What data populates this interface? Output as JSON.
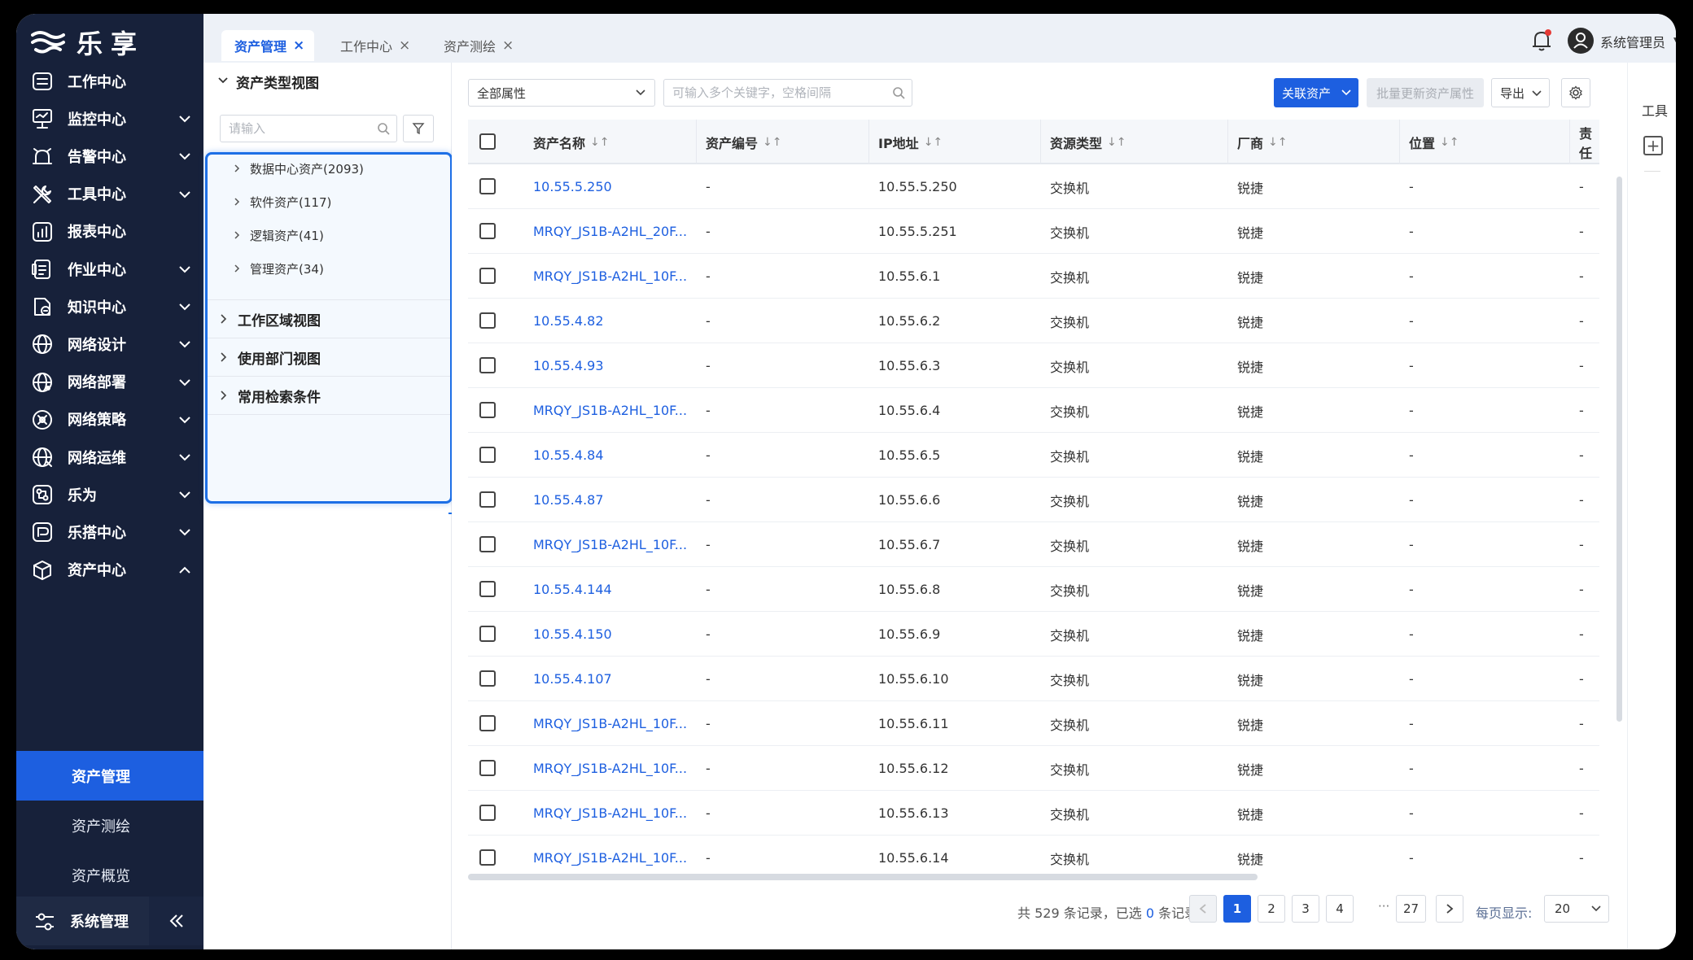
{
  "brand": {
    "name": "乐享"
  },
  "sidebar": {
    "items": [
      {
        "label": "工作中心",
        "icon": "workbench-icon",
        "expandable": false
      },
      {
        "label": "监控中心",
        "icon": "monitor-icon",
        "expandable": true
      },
      {
        "label": "告警中心",
        "icon": "alarm-clock-icon",
        "expandable": true
      },
      {
        "label": "工具中心",
        "icon": "tools-icon",
        "expandable": true
      },
      {
        "label": "报表中心",
        "icon": "report-chart-icon",
        "expandable": false
      },
      {
        "label": "作业中心",
        "icon": "job-list-icon",
        "expandable": true
      },
      {
        "label": "知识中心",
        "icon": "knowledge-icon",
        "expandable": true
      },
      {
        "label": "网络设计",
        "icon": "globe-design-icon",
        "expandable": true
      },
      {
        "label": "网络部署",
        "icon": "globe-deploy-icon",
        "expandable": true
      },
      {
        "label": "网络策略",
        "icon": "network-policy-icon",
        "expandable": true
      },
      {
        "label": "网络运维",
        "icon": "globe-ops-icon",
        "expandable": true
      },
      {
        "label": "乐为",
        "icon": "lewei-icon",
        "expandable": true
      },
      {
        "label": "乐搭中心",
        "icon": "leda-icon",
        "expandable": true
      },
      {
        "label": "资产中心",
        "icon": "cube-icon",
        "expandable": true,
        "expanded": true
      }
    ],
    "subitems": [
      {
        "label": "资产管理",
        "active": true
      },
      {
        "label": "资产测绘",
        "active": false
      },
      {
        "label": "资产概览",
        "active": false
      }
    ],
    "footer": {
      "label": "系统管理",
      "icon": "settings-sliders-icon",
      "collapse_icon": "double-chevron-left-icon"
    }
  },
  "tabs": [
    {
      "label": "资产管理",
      "active": true
    },
    {
      "label": "工作中心",
      "active": false
    },
    {
      "label": "资产测绘",
      "active": false
    }
  ],
  "header": {
    "user_name": "系统管理员",
    "bell_badge_color": "#e53935"
  },
  "tree": {
    "title": "资产类型视图",
    "search_placeholder": "请输入",
    "nodes": [
      {
        "label": "数据中心资产(2093)"
      },
      {
        "label": "软件资产(117)"
      },
      {
        "label": "逻辑资产(41)"
      },
      {
        "label": "管理资产(34)"
      }
    ],
    "sections": [
      "工作区域视图",
      "使用部门视图",
      "常用检索条件"
    ]
  },
  "toolbar": {
    "attr_select": "全部属性",
    "search_placeholder": "可输入多个关键字，空格间隔",
    "link_asset": "关联资产",
    "batch_update": "批量更新资产属性",
    "export": "导出"
  },
  "table": {
    "columns": [
      {
        "label": "资产名称",
        "sortable": true
      },
      {
        "label": "资产编号",
        "sortable": true
      },
      {
        "label": "IP地址",
        "sortable": true
      },
      {
        "label": "资源类型",
        "sortable": true
      },
      {
        "label": "厂商",
        "sortable": true
      },
      {
        "label": "位置",
        "sortable": true
      },
      {
        "label": "责任",
        "sortable": false
      }
    ],
    "rows": [
      {
        "name": "10.55.5.250",
        "code": "-",
        "ip": "10.55.5.250",
        "type": "交换机",
        "vendor": "锐捷",
        "location": "-",
        "owner": "-"
      },
      {
        "name": "MRQY_JS1B-A2HL_20F...",
        "code": "-",
        "ip": "10.55.5.251",
        "type": "交换机",
        "vendor": "锐捷",
        "location": "-",
        "owner": "-"
      },
      {
        "name": "MRQY_JS1B-A2HL_10F...",
        "code": "-",
        "ip": "10.55.6.1",
        "type": "交换机",
        "vendor": "锐捷",
        "location": "-",
        "owner": "-"
      },
      {
        "name": "10.55.4.82",
        "code": "-",
        "ip": "10.55.6.2",
        "type": "交换机",
        "vendor": "锐捷",
        "location": "-",
        "owner": "-"
      },
      {
        "name": "10.55.4.93",
        "code": "-",
        "ip": "10.55.6.3",
        "type": "交换机",
        "vendor": "锐捷",
        "location": "-",
        "owner": "-"
      },
      {
        "name": "MRQY_JS1B-A2HL_10F...",
        "code": "-",
        "ip": "10.55.6.4",
        "type": "交换机",
        "vendor": "锐捷",
        "location": "-",
        "owner": "-"
      },
      {
        "name": "10.55.4.84",
        "code": "-",
        "ip": "10.55.6.5",
        "type": "交换机",
        "vendor": "锐捷",
        "location": "-",
        "owner": "-"
      },
      {
        "name": "10.55.4.87",
        "code": "-",
        "ip": "10.55.6.6",
        "type": "交换机",
        "vendor": "锐捷",
        "location": "-",
        "owner": "-"
      },
      {
        "name": "MRQY_JS1B-A2HL_10F...",
        "code": "-",
        "ip": "10.55.6.7",
        "type": "交换机",
        "vendor": "锐捷",
        "location": "-",
        "owner": "-"
      },
      {
        "name": "10.55.4.144",
        "code": "-",
        "ip": "10.55.6.8",
        "type": "交换机",
        "vendor": "锐捷",
        "location": "-",
        "owner": "-"
      },
      {
        "name": "10.55.4.150",
        "code": "-",
        "ip": "10.55.6.9",
        "type": "交换机",
        "vendor": "锐捷",
        "location": "-",
        "owner": "-"
      },
      {
        "name": "10.55.4.107",
        "code": "-",
        "ip": "10.55.6.10",
        "type": "交换机",
        "vendor": "锐捷",
        "location": "-",
        "owner": "-"
      },
      {
        "name": "MRQY_JS1B-A2HL_10F...",
        "code": "-",
        "ip": "10.55.6.11",
        "type": "交换机",
        "vendor": "锐捷",
        "location": "-",
        "owner": "-"
      },
      {
        "name": "MRQY_JS1B-A2HL_10F...",
        "code": "-",
        "ip": "10.55.6.12",
        "type": "交换机",
        "vendor": "锐捷",
        "location": "-",
        "owner": "-"
      },
      {
        "name": "MRQY_JS1B-A2HL_10F...",
        "code": "-",
        "ip": "10.55.6.13",
        "type": "交换机",
        "vendor": "锐捷",
        "location": "-",
        "owner": "-"
      },
      {
        "name": "MRQY_JS1B-A2HL_10F...",
        "code": "-",
        "ip": "10.55.6.14",
        "type": "交换机",
        "vendor": "锐捷",
        "location": "-",
        "owner": "-"
      }
    ]
  },
  "pagination": {
    "total_prefix": "共 529 条记录，已选 ",
    "selected": "0",
    "total_suffix": " 条记录",
    "pages": [
      "1",
      "2",
      "3",
      "4"
    ],
    "ellipsis": "···",
    "last_page": "27",
    "current": "1",
    "page_size_label": "每页显示:",
    "page_size": "20"
  },
  "toolrail": {
    "label": "工具"
  },
  "colors": {
    "sidebar_bg": "#17213a",
    "accent": "#1d5fe0",
    "active_sub": "#1d5fe0",
    "highlight_border": "#1d6fe6"
  }
}
